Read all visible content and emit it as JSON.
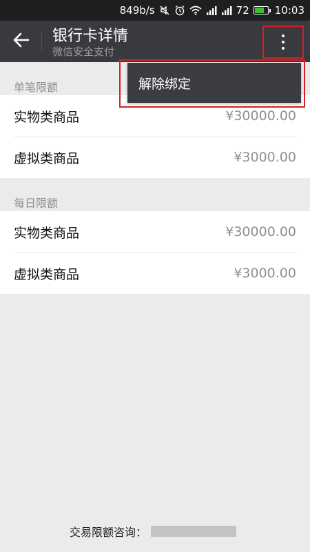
{
  "status_bar": {
    "speed": "849b/s",
    "signal_1": "▐",
    "battery_level": "72",
    "time": "10:03",
    "colors": {
      "background": "#1f1f21",
      "battery_fill": "#3ec12c"
    }
  },
  "header": {
    "title": "银行卡详情",
    "subtitle": "微信安全支付",
    "background": "#393a3f"
  },
  "menu": {
    "items": [
      {
        "label": "解除绑定"
      }
    ]
  },
  "sections": [
    {
      "label": "单笔限额",
      "rows": [
        {
          "label": "实物类商品",
          "value": "¥30000.00"
        },
        {
          "label": "虚拟类商品",
          "value": "¥3000.00"
        }
      ]
    },
    {
      "label": "每日限额",
      "rows": [
        {
          "label": "实物类商品",
          "value": "¥30000.00"
        },
        {
          "label": "虚拟类商品",
          "value": "¥3000.00"
        }
      ]
    }
  ],
  "footer": {
    "label": "交易限额咨询："
  },
  "annotation_color": "#d61f26"
}
